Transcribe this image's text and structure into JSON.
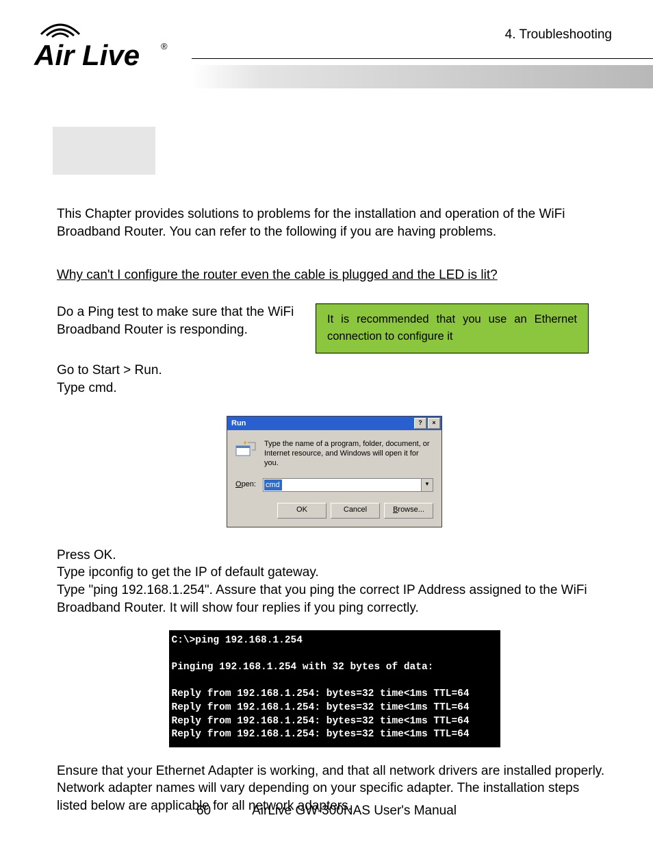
{
  "header": {
    "section": "4.  Troubleshooting",
    "logo_text": "Air Live"
  },
  "intro": "This Chapter provides solutions to problems for the installation and operation of the WiFi Broadband Router. You can refer to the following if you are having problems.",
  "question": "Why can't I configure the router even the cable is plugged and the LED is lit?",
  "ping_instruction": "Do a Ping test to make sure that the WiFi Broadband Router is responding.",
  "tip": "It is recommended that you use an Ethernet connection to configure it",
  "step_run": "Go to Start > Run.",
  "step_cmd": "Type cmd.",
  "run_dialog": {
    "title": "Run",
    "help_btn": "?",
    "close_btn": "×",
    "message": "Type the name of a program, folder, document, or Internet resource, and Windows will open it for you.",
    "open_label_u": "O",
    "open_label_rest": "pen:",
    "open_value": "cmd",
    "ok": "OK",
    "cancel": "Cancel",
    "browse_u": "B",
    "browse_rest": "rowse..."
  },
  "press_ok": "Press OK.",
  "ipconfig": "Type ipconfig to get the IP of default gateway.",
  "ping_cmd": "Type \"ping 192.168.1.254\". Assure that you ping the correct IP Address assigned to the WiFi Broadband Router. It will show four replies if you ping correctly.",
  "cmd_output": "C:\\>ping 192.168.1.254\n\nPinging 192.168.1.254 with 32 bytes of data:\n\nReply from 192.168.1.254: bytes=32 time<1ms TTL=64\nReply from 192.168.1.254: bytes=32 time<1ms TTL=64\nReply from 192.168.1.254: bytes=32 time<1ms TTL=64\nReply from 192.168.1.254: bytes=32 time<1ms TTL=64",
  "ensure": "Ensure that your Ethernet Adapter is working, and that all network drivers are installed properly. Network adapter names will vary depending on your specific adapter. The installation steps listed below are applicable for all network adapters.",
  "footer": {
    "page_num": "60",
    "doc_title": "AirLive GW-300NAS User's Manual"
  }
}
